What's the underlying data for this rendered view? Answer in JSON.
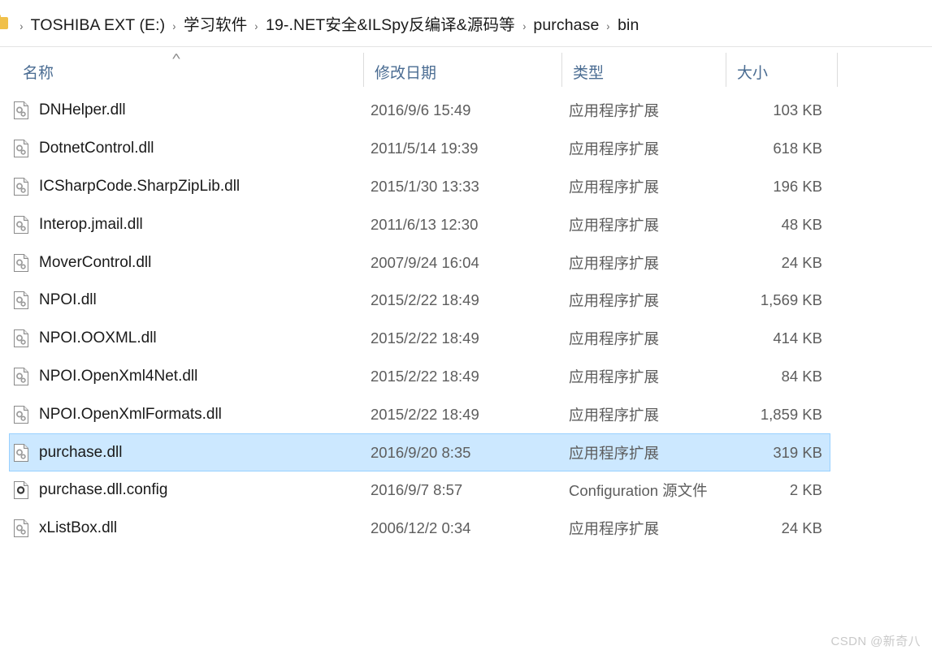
{
  "breadcrumb": {
    "folder_icon": "folder-icon",
    "separator": "›",
    "items": [
      "TOSHIBA EXT (E:)",
      "学习软件",
      "19-.NET安全&ILSpy反编译&源码等",
      "purchase",
      "bin"
    ]
  },
  "columns": {
    "name": "名称",
    "date": "修改日期",
    "type": "类型",
    "size": "大小",
    "sort_arrow": "˄",
    "sorted_by": "名称",
    "sort_direction": "ascending"
  },
  "files": [
    {
      "name": "DNHelper.dll",
      "date": "2016/9/6 15:49",
      "type": "应用程序扩展",
      "size": "103 KB",
      "icon": "dll-file-icon",
      "selected": false
    },
    {
      "name": "DotnetControl.dll",
      "date": "2011/5/14 19:39",
      "type": "应用程序扩展",
      "size": "618 KB",
      "icon": "dll-file-icon",
      "selected": false
    },
    {
      "name": "ICSharpCode.SharpZipLib.dll",
      "date": "2015/1/30 13:33",
      "type": "应用程序扩展",
      "size": "196 KB",
      "icon": "dll-file-icon",
      "selected": false
    },
    {
      "name": "Interop.jmail.dll",
      "date": "2011/6/13 12:30",
      "type": "应用程序扩展",
      "size": "48 KB",
      "icon": "dll-file-icon",
      "selected": false
    },
    {
      "name": "MoverControl.dll",
      "date": "2007/9/24 16:04",
      "type": "应用程序扩展",
      "size": "24 KB",
      "icon": "dll-file-icon",
      "selected": false
    },
    {
      "name": "NPOI.dll",
      "date": "2015/2/22 18:49",
      "type": "应用程序扩展",
      "size": "1,569 KB",
      "icon": "dll-file-icon",
      "selected": false
    },
    {
      "name": "NPOI.OOXML.dll",
      "date": "2015/2/22 18:49",
      "type": "应用程序扩展",
      "size": "414 KB",
      "icon": "dll-file-icon",
      "selected": false
    },
    {
      "name": "NPOI.OpenXml4Net.dll",
      "date": "2015/2/22 18:49",
      "type": "应用程序扩展",
      "size": "84 KB",
      "icon": "dll-file-icon",
      "selected": false
    },
    {
      "name": "NPOI.OpenXmlFormats.dll",
      "date": "2015/2/22 18:49",
      "type": "应用程序扩展",
      "size": "1,859 KB",
      "icon": "dll-file-icon",
      "selected": false
    },
    {
      "name": "purchase.dll",
      "date": "2016/9/20 8:35",
      "type": "应用程序扩展",
      "size": "319 KB",
      "icon": "dll-file-icon",
      "selected": true
    },
    {
      "name": "purchase.dll.config",
      "date": "2016/9/7 8:57",
      "type": "Configuration 源文件",
      "size": "2 KB",
      "icon": "config-file-icon",
      "selected": false
    },
    {
      "name": "xListBox.dll",
      "date": "2006/12/2 0:34",
      "type": "应用程序扩展",
      "size": "24 KB",
      "icon": "dll-file-icon",
      "selected": false
    }
  ],
  "watermark": {
    "text": "CSDN @新奇八"
  },
  "colors": {
    "selection_fill": "#cce8ff",
    "selection_border": "#99d1ff",
    "header_text": "#4a6c92",
    "body_text": "#1a1a1a",
    "secondary_text": "#5d5d5d",
    "folder_icon": "#f0c04a",
    "watermark": "#c9c9c9"
  }
}
